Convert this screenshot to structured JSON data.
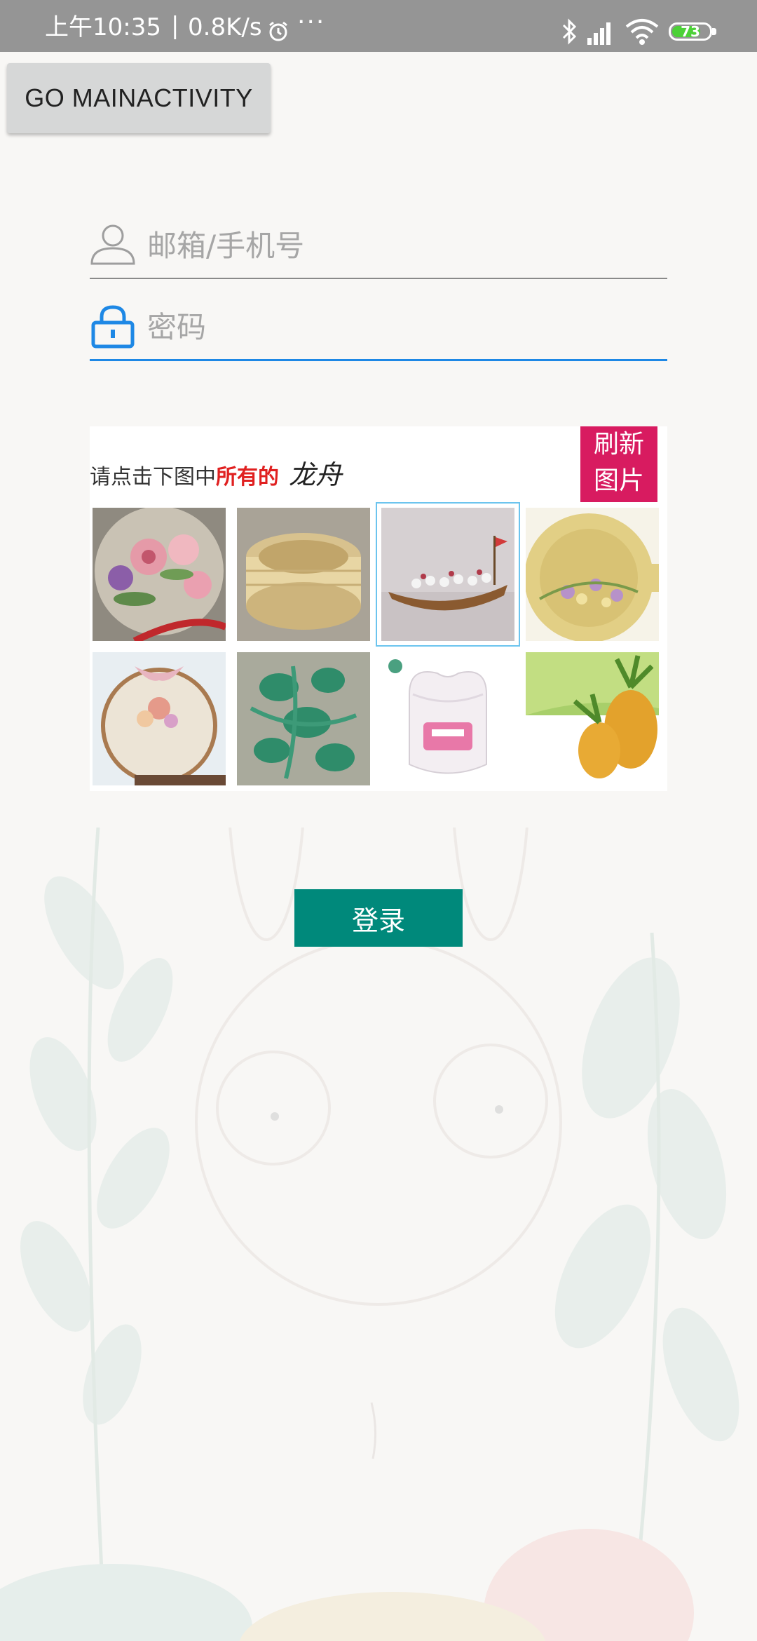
{
  "status_bar": {
    "time": "上午10:35",
    "separator": "|",
    "net_speed": "0.8K/s",
    "more": "···",
    "battery": "73",
    "icons": [
      "alarm-icon",
      "bluetooth-icon",
      "signal-icon",
      "wifi-icon",
      "battery-icon"
    ]
  },
  "go_main_button": {
    "label": "GO MAINACTIVITY"
  },
  "form": {
    "email_placeholder": "邮箱/手机号",
    "password_placeholder": "密码"
  },
  "captcha": {
    "instruction_prefix": "请点击下图中",
    "instruction_highlight": "所有的",
    "instruction_keyword": "龙舟",
    "refresh_line1": "刷新",
    "refresh_line2": "图片",
    "tiles": [
      {
        "subject": "embroidery-flowers",
        "selected": false
      },
      {
        "subject": "bamboo-steamer",
        "selected": false
      },
      {
        "subject": "dragon-boat",
        "selected": true
      },
      {
        "subject": "gold-plate-flowers",
        "selected": false
      },
      {
        "subject": "embroidery-hoop",
        "selected": false
      },
      {
        "subject": "green-embroidery",
        "selected": false
      },
      {
        "subject": "cotton-swab-box",
        "selected": false
      },
      {
        "subject": "pineapple",
        "selected": false
      }
    ]
  },
  "login_button": {
    "label": "登录"
  },
  "colors": {
    "status_bar": "#959595",
    "accent_blue": "#1e88e5",
    "refresh_pink": "#d81b60",
    "login_teal": "#00897b"
  }
}
